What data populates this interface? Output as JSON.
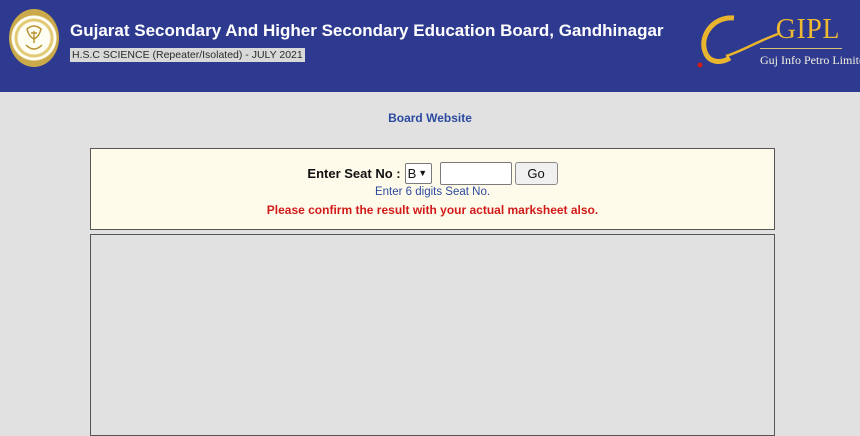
{
  "header": {
    "title": "Gujarat Secondary And Higher Secondary Education Board, Gandhinagar",
    "subtitle": "H.S.C SCIENCE (Repeater/Isolated) - JULY 2021",
    "logo_text": "GIPL",
    "logo_subtext": "Guj Info Petro Limited",
    "background_color": "#2d3a8f"
  },
  "nav": {
    "board_website_link": "Board Website"
  },
  "form": {
    "seat_label": "Enter Seat No :",
    "series_selected": "B",
    "seat_value": "",
    "go_label": "Go",
    "hint": "Enter 6 digits Seat No.",
    "warning": "Please confirm the result with your actual marksheet also.",
    "warning_color": "#d11a1a"
  }
}
